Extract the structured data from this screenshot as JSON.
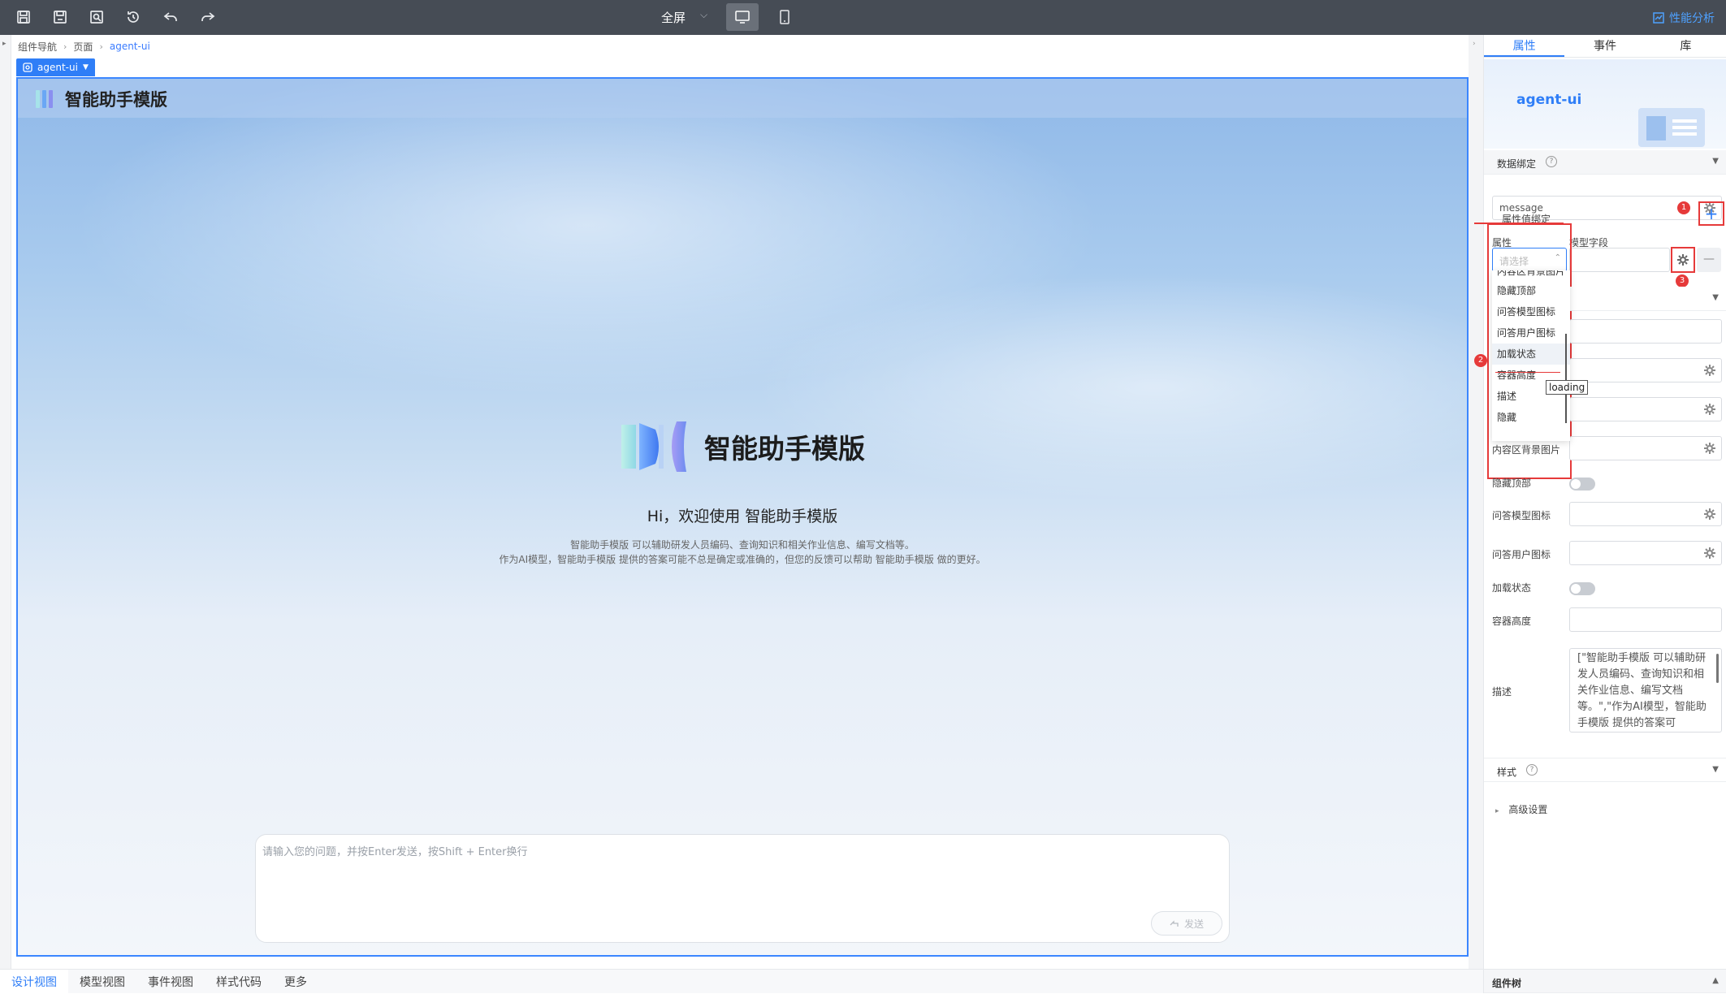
{
  "toolbar": {
    "icons": [
      "save-icon",
      "save-as-icon",
      "preview-icon",
      "history-icon",
      "undo-icon",
      "redo-icon"
    ],
    "fullscreen_label": "全屏",
    "performance_label": "性能分析"
  },
  "breadcrumb": [
    "组件导航",
    "页面",
    "agent-ui"
  ],
  "canvas": {
    "component_tag": "agent-ui",
    "header_title": "智能助手模版",
    "hero_title": "智能助手模版",
    "greeting": "Hi，欢迎使用 智能助手模版",
    "desc_line1": "智能助手模版 可以辅助研发人员编码、查询知识和相关作业信息、编写文档等。",
    "desc_line2": "作为AI模型，智能助手模版 提供的答案可能不总是确定或准确的，但您的反馈可以帮助 智能助手模版 做的更好。",
    "input_placeholder": "请输入您的问题，并按Enter发送，按Shift + Enter换行",
    "send_label": "发送"
  },
  "bottom_tabs": [
    "设计视图",
    "模型视图",
    "事件视图",
    "样式代码",
    "更多"
  ],
  "right_panel": {
    "tabs": [
      "属性",
      "事件",
      "库"
    ],
    "component_name": "agent-ui",
    "data_binding_title": "数据绑定",
    "message_value": "message",
    "attr_binding_label": "属性值绑定",
    "col_attr": "属性",
    "col_model_field": "模型字段",
    "select_placeholder": "请选择",
    "dropdown_items": [
      "内容区背景图片",
      "隐藏顶部",
      "问答模型图标",
      "问答用户图标",
      "加载状态",
      "容器高度",
      "描述",
      "隐藏"
    ],
    "tooltip": "loading",
    "props": {
      "content_bg": "内容区背景图片",
      "hide_top": "隐藏顶部",
      "model_icon": "问答模型图标",
      "user_icon": "问答用户图标",
      "loading": "加载状态",
      "height": "容器高度",
      "desc": "描述"
    },
    "desc_value": "[\"智能助手模版 可以辅助研发人员编码、查询知识和相关作业信息、编写文档等。\",\"作为AI模型，智能助手模版 提供的答案可",
    "style_title": "样式",
    "advanced": "高级设置",
    "component_tree": "组件树",
    "badges": [
      "1",
      "2",
      "3"
    ]
  }
}
